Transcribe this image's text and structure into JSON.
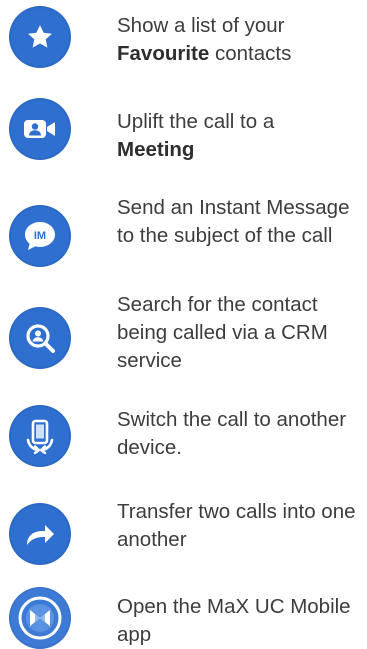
{
  "accent_color": "#2f6fcf",
  "items": [
    {
      "icon": "star-icon",
      "line1": "Show a list of your",
      "bold": "Favourite",
      "after": " contacts"
    },
    {
      "icon": "meeting-video-icon",
      "line1": "Uplift the call to a",
      "bold": "Meeting",
      "after": ""
    },
    {
      "icon": "instant-message-icon",
      "icon_text": "IM",
      "text": "Send an Instant Message to the subject of the call"
    },
    {
      "icon": "crm-search-icon",
      "text": "Search for the contact being called via a CRM service"
    },
    {
      "icon": "switch-device-icon",
      "text": "Switch the call to another device."
    },
    {
      "icon": "transfer-arrow-icon",
      "text": "Transfer two calls into one another"
    },
    {
      "icon": "max-uc-logo-icon",
      "text": "Open the MaX UC Mobile app"
    }
  ]
}
